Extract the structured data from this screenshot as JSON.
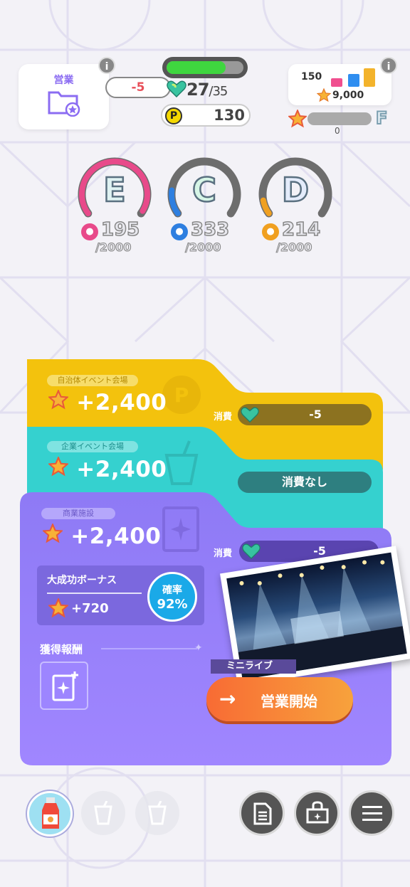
{
  "eigyo": {
    "label": "営業",
    "info": "i"
  },
  "stamina": {
    "cost": "-5",
    "current": "27",
    "max": "/35",
    "fill_fraction": 0.77
  },
  "coins": {
    "icon": "P",
    "value": "130"
  },
  "fans": {
    "count": "150",
    "total": "9,000",
    "info": "i"
  },
  "rank": {
    "letter": "F",
    "progress": "0"
  },
  "stats": [
    {
      "grade": "E",
      "icon": "mic-icon",
      "value": "195",
      "max": "/2000",
      "color": "#e84a8a"
    },
    {
      "grade": "C",
      "icon": "shoe-icon",
      "value": "333",
      "max": "/2000",
      "color": "#2e7fe0"
    },
    {
      "grade": "D",
      "icon": "face-icon",
      "value": "214",
      "max": "/2000",
      "color": "#f0a020"
    }
  ],
  "cards": [
    {
      "tag": "自治体イベント会場",
      "reward": "+2,400",
      "consume_label": "消費",
      "consume_value": "-5"
    },
    {
      "tag": "企業イベント会場",
      "reward": "+2,400",
      "consume_value": "消費なし"
    },
    {
      "tag": "商業施設",
      "reward": "+2,400",
      "consume_label": "消費",
      "consume_value": "-5"
    }
  ],
  "bonus": {
    "title": "大成功ボーナス",
    "value": "+720",
    "prob_label": "確率",
    "prob_value": "92%"
  },
  "reward_title": "獲得報酬",
  "live_label": "ミニライブ",
  "start_button": "営業開始",
  "bottom": {
    "icons": [
      "drink-icon",
      "cup-icon",
      "cup-icon",
      "document-icon",
      "shop-icon",
      "menu-icon"
    ]
  }
}
